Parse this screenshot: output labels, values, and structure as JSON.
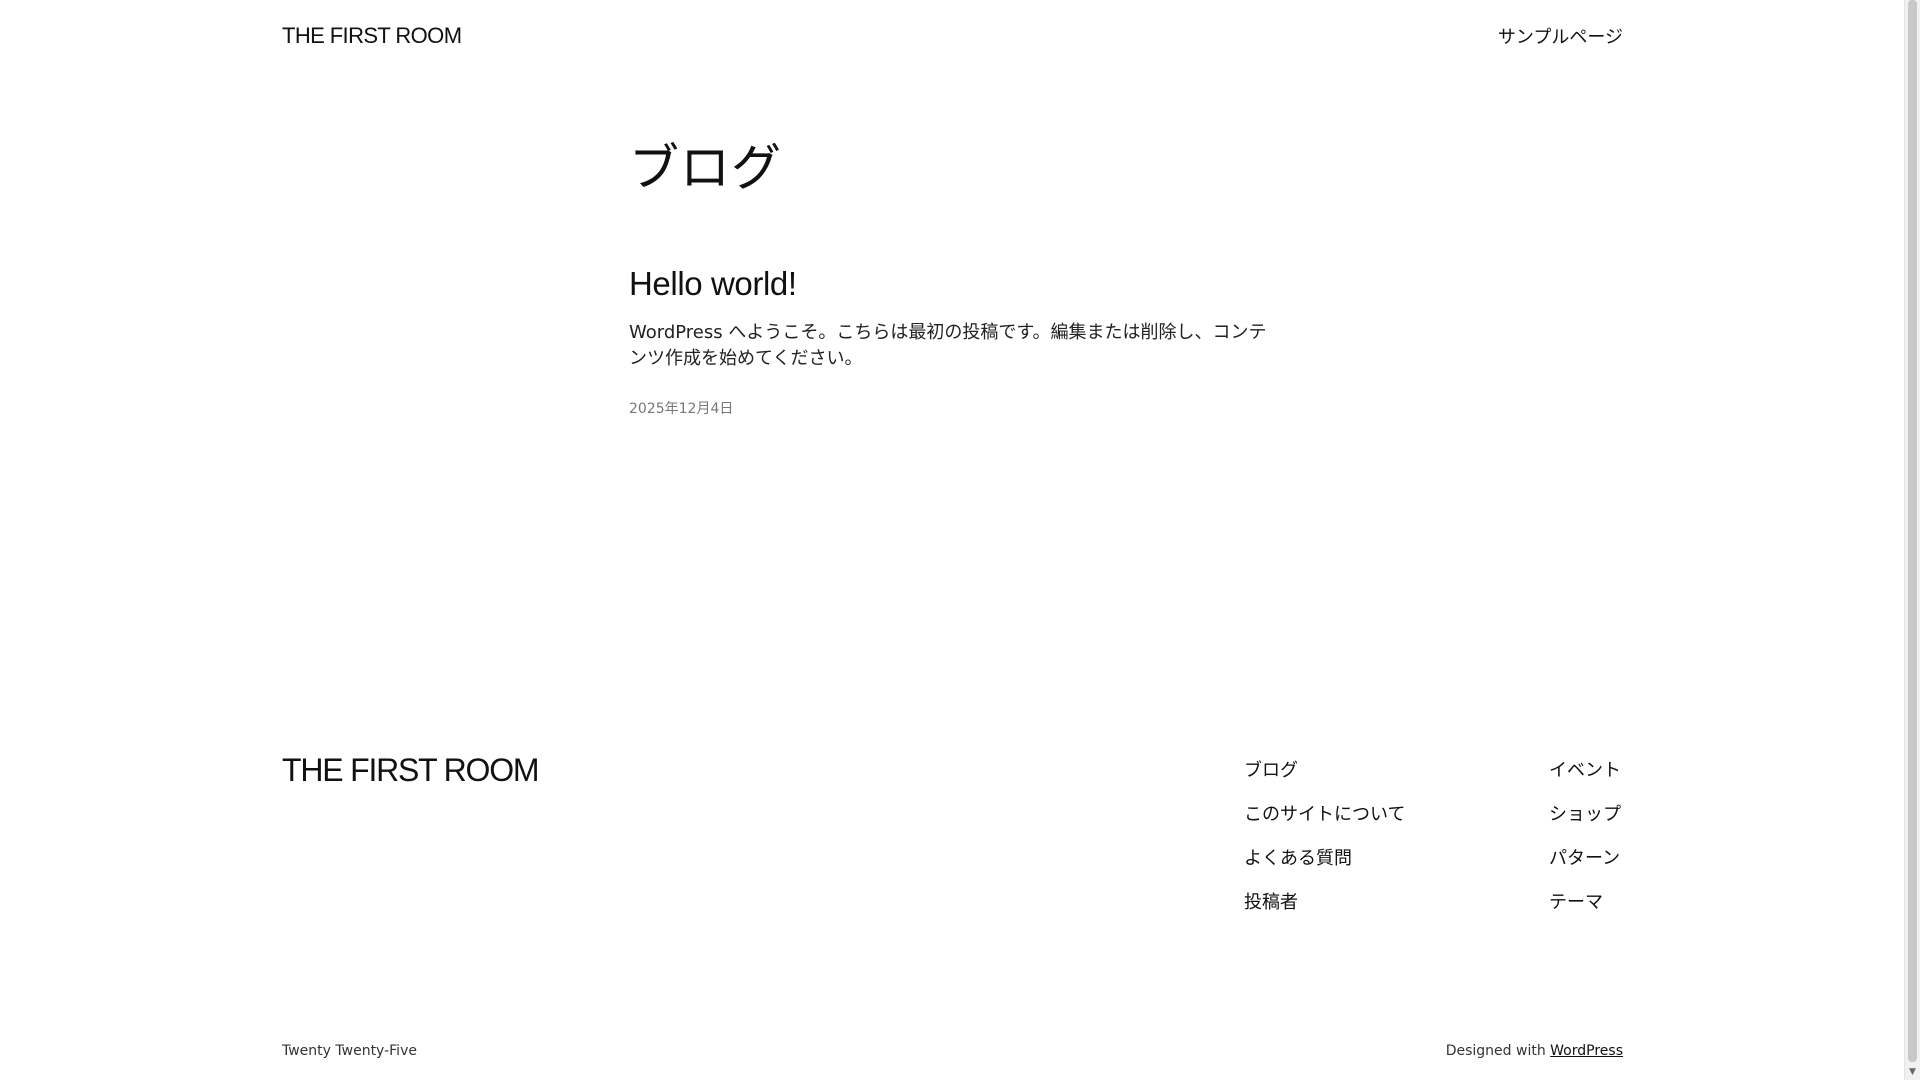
{
  "header": {
    "site_title": "THE FIRST ROOM",
    "nav": [
      {
        "label": "サンプルページ"
      }
    ]
  },
  "main": {
    "heading": "ブログ",
    "posts": [
      {
        "title": "Hello world!",
        "excerpt": "WordPress へようこそ。こちらは最初の投稿です。編集または削除し、コンテンツ作成を始めてください。",
        "date": "2025年12月4日"
      }
    ]
  },
  "footer": {
    "site_title": "THE FIRST ROOM",
    "nav_col1": [
      {
        "label": "ブログ"
      },
      {
        "label": "このサイトについて"
      },
      {
        "label": "よくある質問"
      },
      {
        "label": "投稿者"
      }
    ],
    "nav_col2": [
      {
        "label": "イベント"
      },
      {
        "label": "ショップ"
      },
      {
        "label": "パターン"
      },
      {
        "label": "テーマ"
      }
    ],
    "theme_name": "Twenty Twenty-Five",
    "credit_prefix": "Designed with",
    "credit_link": "WordPress"
  },
  "icons": {
    "scroll_up": "chevron-up-icon",
    "scroll_down": "chevron-down-icon"
  }
}
